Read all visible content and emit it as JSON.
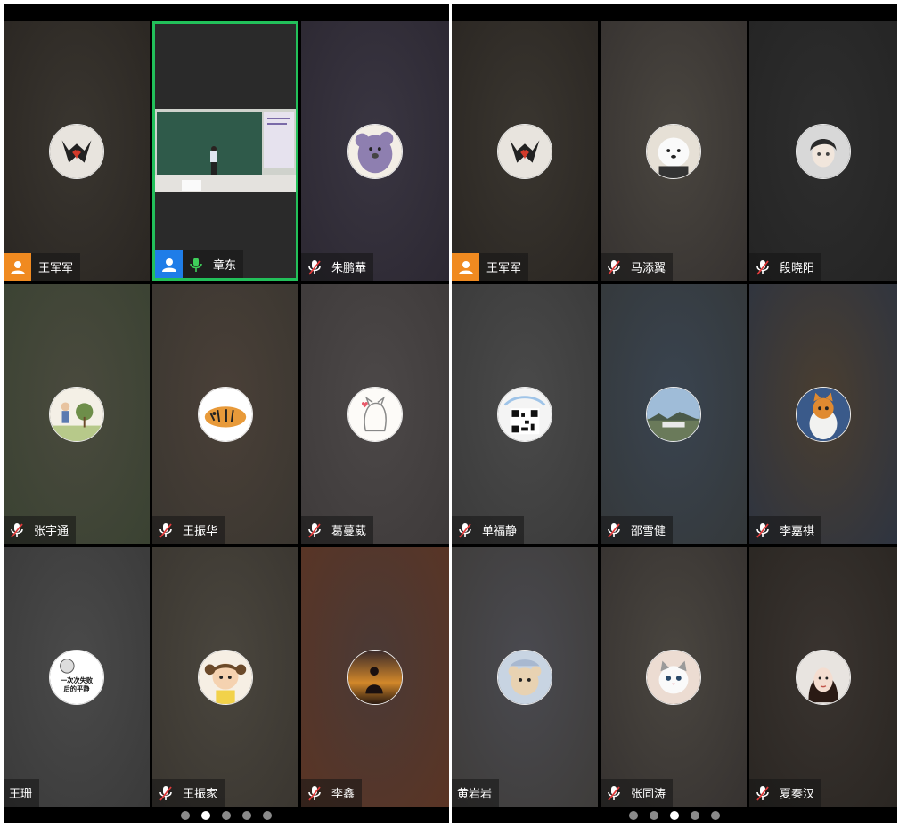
{
  "panels": [
    {
      "page_indicator": {
        "count": 5,
        "active": 1
      },
      "tiles": [
        {
          "name": "王军军",
          "host_role": "host",
          "mic": "none",
          "avatar": "heart-hands-avatar",
          "bg": [
            "#3a3630",
            "#2a2622"
          ]
        },
        {
          "name": "章东",
          "host_role": "cohost",
          "mic": "on",
          "avatar": "screen-share-classroom",
          "bg": [
            "#2a2a2a",
            "#2a2a2a"
          ],
          "sharing": true
        },
        {
          "name": "朱鹏華",
          "host_role": "none",
          "mic": "muted",
          "avatar": "purple-koala-avatar",
          "bg": [
            "#3a3642",
            "#2c2832"
          ]
        },
        {
          "name": "张宇通",
          "host_role": "none",
          "mic": "muted",
          "avatar": "cartoon-garden-avatar",
          "bg": [
            "#4a4a3e",
            "#3a4232"
          ]
        },
        {
          "name": "王振华",
          "host_role": "none",
          "mic": "muted",
          "avatar": "tiger-avatar",
          "bg": [
            "#4a4038",
            "#3a3630"
          ]
        },
        {
          "name": "葛蔓葳",
          "host_role": "none",
          "mic": "muted",
          "avatar": "sketch-cat-avatar",
          "bg": [
            "#4c4848",
            "#3e3a3a"
          ]
        },
        {
          "name": "王珊",
          "host_role": "none",
          "mic": "none",
          "avatar": "sticker-text-avatar",
          "bg": [
            "#4a4a4a",
            "#3a3a3a"
          ]
        },
        {
          "name": "王振家",
          "host_role": "none",
          "mic": "muted",
          "avatar": "cartoon-girl-avatar",
          "bg": [
            "#4a463e",
            "#3a3630"
          ]
        },
        {
          "name": "李鑫",
          "host_role": "none",
          "mic": "muted",
          "avatar": "sunset-silhouette-avatar",
          "bg": [
            "#4a3a36",
            "#5a3424"
          ]
        }
      ],
      "sticker_text": [
        "一次次失败",
        "后的平静"
      ]
    },
    {
      "page_indicator": {
        "count": 5,
        "active": 2
      },
      "tiles": [
        {
          "name": "王军军",
          "host_role": "host",
          "mic": "none",
          "avatar": "heart-hands-avatar",
          "bg": [
            "#3a3630",
            "#2a2622"
          ]
        },
        {
          "name": "马添翼",
          "host_role": "none",
          "mic": "muted",
          "avatar": "white-dog-avatar",
          "bg": [
            "#4a4640",
            "#363230"
          ]
        },
        {
          "name": "段晓阳",
          "host_role": "none",
          "mic": "muted",
          "avatar": "anime-boy-avatar",
          "bg": [
            "#2e2e2e",
            "#242424"
          ]
        },
        {
          "name": "单福静",
          "host_role": "none",
          "mic": "muted",
          "avatar": "qr-code-avatar",
          "bg": [
            "#4a4a4a",
            "#3a3a3a"
          ]
        },
        {
          "name": "邵雪健",
          "host_role": "none",
          "mic": "muted",
          "avatar": "landscape-avatar",
          "bg": [
            "#3a4450",
            "#34383a"
          ]
        },
        {
          "name": "李嘉祺",
          "host_role": "none",
          "mic": "muted",
          "avatar": "orange-cat-avatar",
          "bg": [
            "#4a3e30",
            "#2e3440"
          ]
        },
        {
          "name": "黄岩岩",
          "host_role": "none",
          "mic": "none",
          "avatar": "teddy-bear-avatar",
          "bg": [
            "#4a4a50",
            "#3e3c3a"
          ]
        },
        {
          "name": "张同涛",
          "host_role": "none",
          "mic": "muted",
          "avatar": "kitten-avatar",
          "bg": [
            "#4a4640",
            "#363230"
          ]
        },
        {
          "name": "夏秦汉",
          "host_role": "none",
          "mic": "muted",
          "avatar": "girl-portrait-avatar",
          "bg": [
            "#3a3430",
            "#2a2622"
          ]
        }
      ]
    }
  ],
  "colors": {
    "host": "#f08a20",
    "cohost": "#1f7de8",
    "mic_on": "#3ecf5a",
    "share_border": "#22c05a"
  }
}
